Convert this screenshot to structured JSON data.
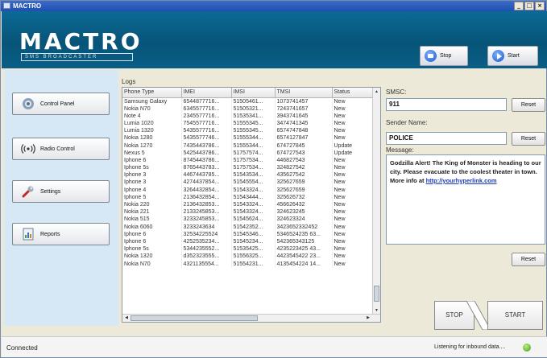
{
  "window": {
    "title": "MACTRO",
    "controls": [
      "_",
      "□",
      "×"
    ]
  },
  "header": {
    "logo": "MACTRO",
    "sublogo": "SMS BROADCASTER",
    "stop_label": "Stop",
    "start_label": "Start"
  },
  "nav": [
    {
      "label": "Control Panel",
      "icon": "gear-icon"
    },
    {
      "label": "Radio Control",
      "icon": "radio-icon"
    },
    {
      "label": "Settings",
      "icon": "wrench-icon"
    },
    {
      "label": "Reports",
      "icon": "reports-icon"
    }
  ],
  "logs": {
    "label": "Logs",
    "columns": [
      "Phone Type",
      "IMEI",
      "IMSI",
      "TMSI",
      "Status"
    ],
    "rows": [
      [
        "Samsung Galaxy",
        "6544877716...",
        "51505461...",
        "1073741457",
        "New"
      ],
      [
        "Nokia N70",
        "6345577716...",
        "51505321...",
        "7243741657",
        "New"
      ],
      [
        "Note 4",
        "2345577716...",
        "51535341...",
        "3943741645",
        "New"
      ],
      [
        "Lumia 1020",
        "7545577716...",
        "51555345...",
        "3474741345",
        "New"
      ],
      [
        "Lumia 1320",
        "5435577716...",
        "51555345...",
        "6574747848",
        "New"
      ],
      [
        "Nokia 1280",
        "5435577746...",
        "51555344...",
        "6574127847",
        "New"
      ],
      [
        "Nokia 1270",
        "7435443786...",
        "51555344...",
        "674727845",
        "Update"
      ],
      [
        "Nexus 5",
        "5425443786...",
        "51757574...",
        "674727543",
        "Update"
      ],
      [
        "Iphone 6",
        "8745443786...",
        "51757534...",
        "446827543",
        "New"
      ],
      [
        "Iphone 5s",
        "8765443783...",
        "51757534...",
        "324827542",
        "New"
      ],
      [
        "Iphone 3",
        "4467443785...",
        "51543534...",
        "435627542",
        "New"
      ],
      [
        "Iphone 3",
        "4274437854...",
        "51545554...",
        "325627659",
        "New"
      ],
      [
        "Iphone 4",
        "3264432854...",
        "51543324...",
        "325627659",
        "New"
      ],
      [
        "Iphone 5",
        "2136432854...",
        "51543444...",
        "325626732",
        "New"
      ],
      [
        "Nokia 220",
        "2136432853...",
        "51543324...",
        "456626432",
        "New"
      ],
      [
        "Nokia 221",
        "2133245853...",
        "51543324...",
        "324623245",
        "New"
      ],
      [
        "Nokia 515",
        "3233245853...",
        "51545624...",
        "324623324",
        "New"
      ],
      [
        "Nokia 6060",
        "3233243634",
        "51542352...",
        "3423652332452",
        "New"
      ],
      [
        "Iphone 6",
        "32534225524",
        "51545346...",
        "5346524235 63...",
        "New"
      ],
      [
        "Iphone 6",
        "4252535234...",
        "51545234...",
        "542365343125",
        "New"
      ],
      [
        "Iphone 5s",
        "5344235552...",
        "51535425...",
        "4235223425 43...",
        "New"
      ],
      [
        "Nokia 1320",
        "d352323555...",
        "51556325...",
        "4423545422 23...",
        "New"
      ],
      [
        "Nokia N70",
        "4321135554...",
        "51554231...",
        "4135454224 14...",
        "New"
      ]
    ]
  },
  "smsc": {
    "label": "SMSC:",
    "value": "911",
    "reset_label": "Reset"
  },
  "sender": {
    "label": "Sender Name:",
    "value": "POLICE",
    "reset_label": "Reset"
  },
  "message": {
    "label": "Message:",
    "text": "Godzilla Alert! The King of Monster is heading to our city. Please evacuate to the coolest theater in town. More info at ",
    "link": "http://yourhyperlink.com",
    "reset_label": "Reset"
  },
  "actions": {
    "stop_label": "STOP",
    "start_label": "START"
  },
  "status": {
    "left": "Connected",
    "right": "Listening for inbound data....",
    "indicator_color": "#3f9c1a"
  }
}
